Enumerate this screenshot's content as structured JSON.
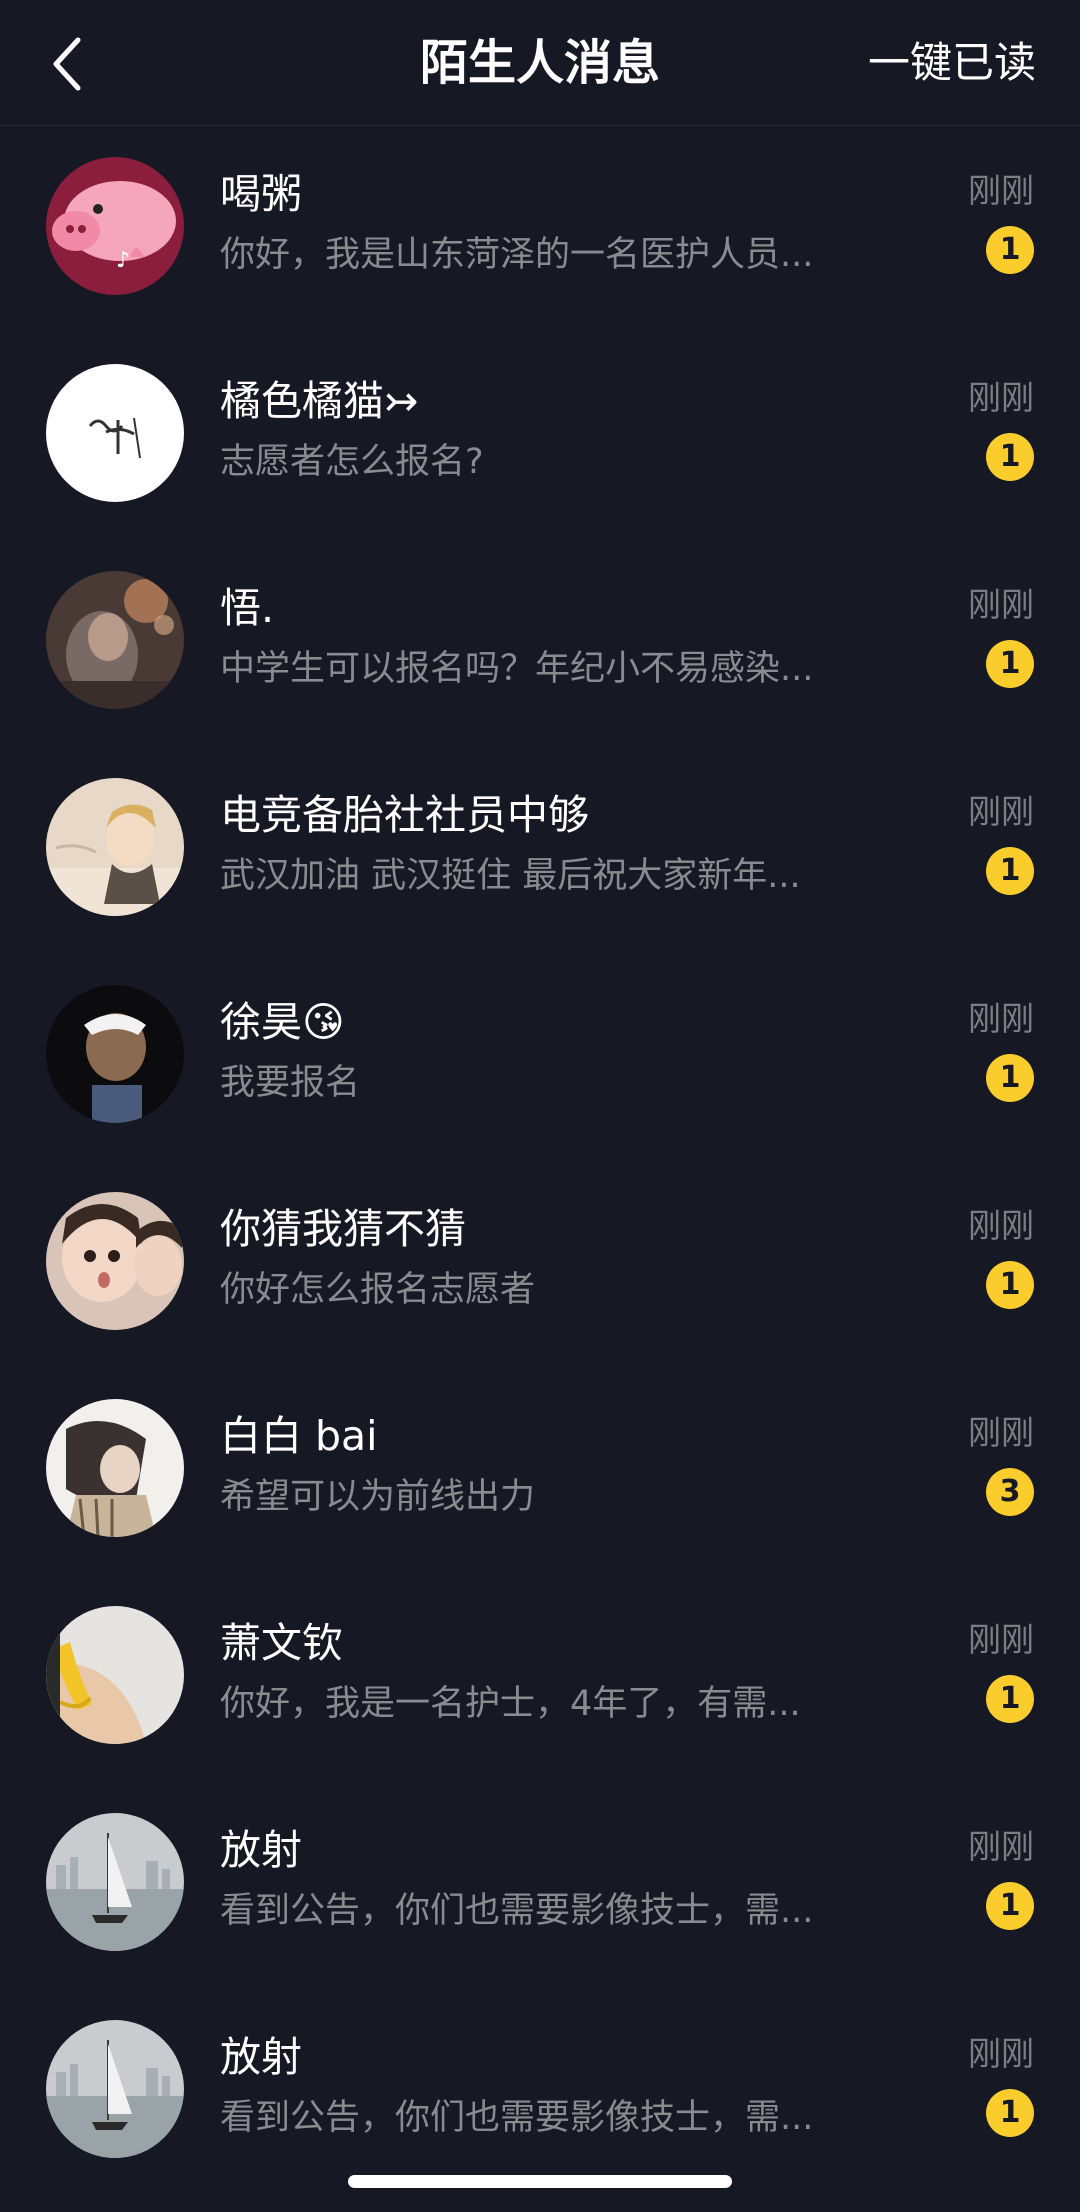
{
  "header": {
    "title": "陌生人消息",
    "mark_all_read_label": "一键已读",
    "back_icon": "chevron-left-icon"
  },
  "messages": [
    {
      "name": "喝粥",
      "preview": "你好，我是山东菏泽的一名医护人员...",
      "time": "刚刚",
      "unread": "1"
    },
    {
      "name": "橘色橘猫↣",
      "preview": "志愿者怎么报名?",
      "time": "刚刚",
      "unread": "1"
    },
    {
      "name": "悟.",
      "preview": "中学生可以报名吗？年纪小不易感染...",
      "time": "刚刚",
      "unread": "1"
    },
    {
      "name": "电竞备胎社社员中够",
      "preview": "武汉加油 武汉挺住  最后祝大家新年...",
      "time": "刚刚",
      "unread": "1"
    },
    {
      "name": "徐昊😘",
      "preview": "我要报名",
      "time": "刚刚",
      "unread": "1"
    },
    {
      "name": "你猜我猜不猜",
      "preview": "你好怎么报名志愿者",
      "time": "刚刚",
      "unread": "1"
    },
    {
      "name": "白白 bai",
      "preview": "希望可以为前线出力",
      "time": "刚刚",
      "unread": "3"
    },
    {
      "name": "萧文钦",
      "preview": "你好，我是一名护士，4年了，有需...",
      "time": "刚刚",
      "unread": "1"
    },
    {
      "name": "放射",
      "preview": "看到公告，你们也需要影像技士，需...",
      "time": "刚刚",
      "unread": "1"
    },
    {
      "name": "放射",
      "preview": "看到公告，你们也需要影像技士，需...",
      "time": "刚刚",
      "unread": "1"
    }
  ],
  "colors": {
    "background": "#161823",
    "badge": "#facd2c",
    "secondary_text": "#8a8b91"
  }
}
